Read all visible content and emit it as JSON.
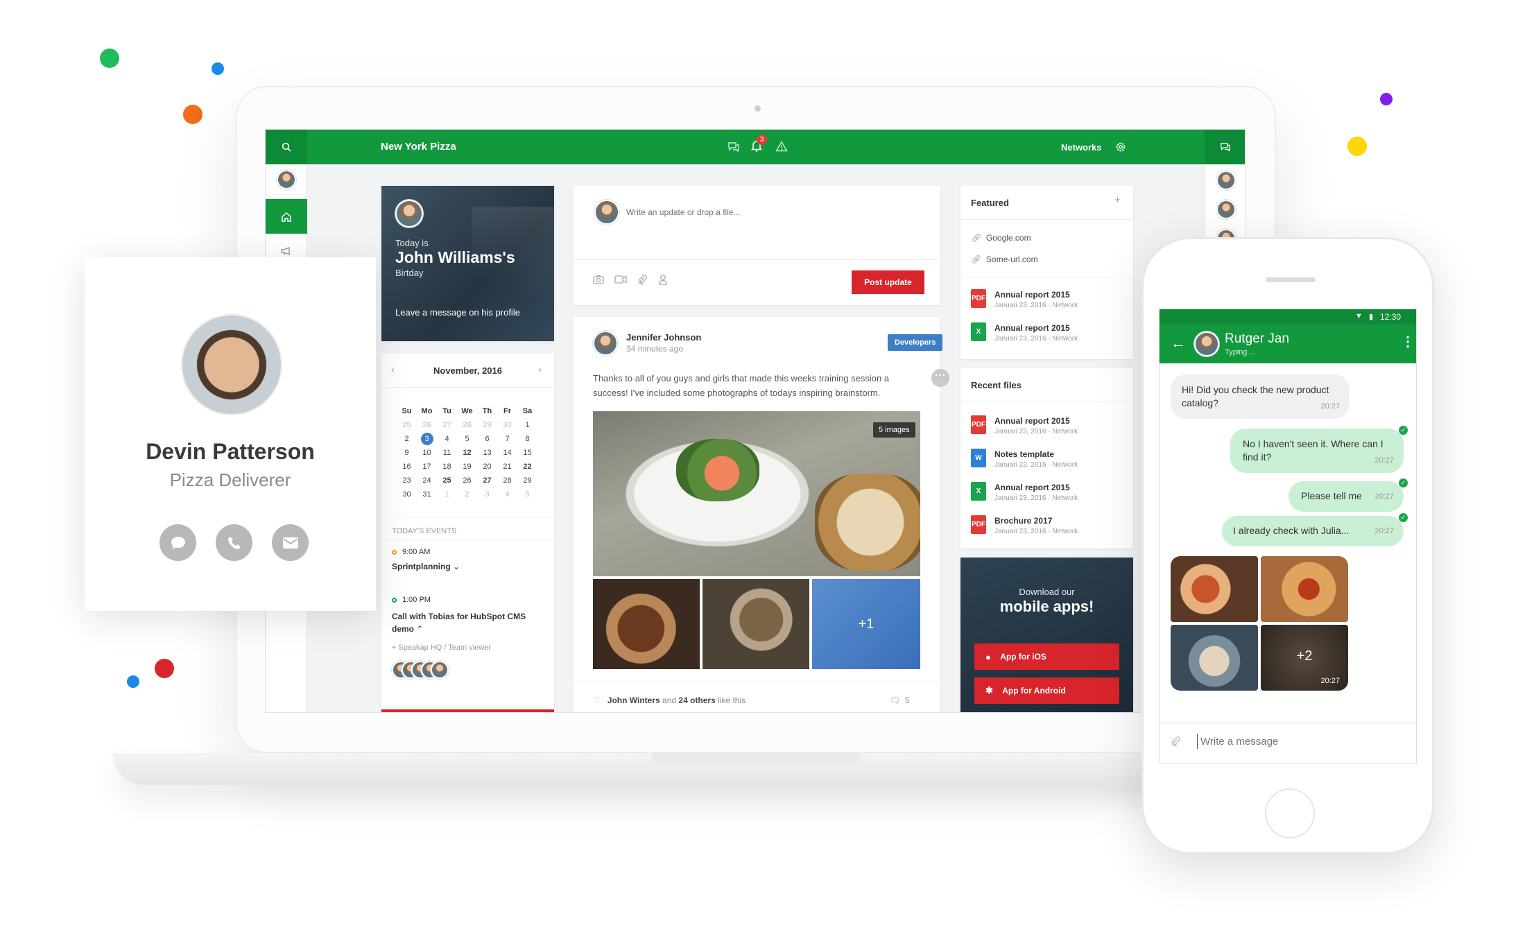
{
  "colors": {
    "brand_green": "#12993e",
    "accent_red": "#d8252b",
    "accent_blue": "#3e7ec5"
  },
  "header": {
    "title": "New York Pizza",
    "networks": "Networks",
    "notification_count": "3"
  },
  "birthday": {
    "today": "Today is",
    "name": "John Williams's",
    "subtitle": "Birtday",
    "cta": "Leave a message on his profile"
  },
  "calendar": {
    "month": "November, 2016",
    "weekdays": [
      "Su",
      "Mo",
      "Tu",
      "We",
      "Th",
      "Fr",
      "Sa"
    ],
    "weeks": [
      [
        "25",
        "26",
        "27",
        "28",
        "29",
        "30",
        "1"
      ],
      [
        "2",
        "3",
        "4",
        "5",
        "6",
        "7",
        "8"
      ],
      [
        "9",
        "10",
        "11",
        "12",
        "13",
        "14",
        "15"
      ],
      [
        "16",
        "17",
        "18",
        "19",
        "20",
        "21",
        "22"
      ],
      [
        "23",
        "24",
        "25",
        "26",
        "27",
        "28",
        "29"
      ],
      [
        "30",
        "31",
        "1",
        "2",
        "3",
        "4",
        "5"
      ]
    ]
  },
  "events": {
    "heading": "TODAY'S EVENTS",
    "items": [
      {
        "time": "9:00 AM",
        "title": "Sprintplanning"
      },
      {
        "time": "1:00 PM",
        "title": "Call with Tobias for HubSpot CMS demo",
        "location": "Speakap HQ / Team viewer"
      }
    ]
  },
  "composer": {
    "placeholder": "Write an update or drop a file...",
    "post_button": "Post update"
  },
  "post": {
    "author": "Jennifer Johnson",
    "time": "34 minutes ago",
    "tag": "Developers",
    "text": "Thanks to all of you guys and girls that made this weeks training session a success! I've included some photographs of todays inspiring brainstorm.",
    "images_badge": "5 images",
    "more_count": "+1",
    "likes_name": "John Winters",
    "likes_and": "and",
    "likes_others": "24 others",
    "likes_suffix": "like this",
    "comments": "5"
  },
  "featured": {
    "heading": "Featured",
    "links": [
      "Google.com",
      "Some-url.com"
    ],
    "files": [
      {
        "name": "Annual report 2015",
        "meta": "Januari 23, 2016 · Network",
        "type": "pdf"
      },
      {
        "name": "Annual report 2015",
        "meta": "Januari 23, 2016 · Network",
        "type": "xls"
      }
    ]
  },
  "recent": {
    "heading": "Recent files",
    "files": [
      {
        "name": "Annual report 2015",
        "meta": "Januari 23, 2016 · Network",
        "type": "pdf"
      },
      {
        "name": "Notes template",
        "meta": "Januari 23, 2016 · Network",
        "type": "doc"
      },
      {
        "name": "Annual report 2015",
        "meta": "Januari 23, 2016 · Network",
        "type": "xls"
      },
      {
        "name": "Brochure 2017",
        "meta": "Januari 23, 2016 · Network",
        "type": "pdf"
      }
    ]
  },
  "apps": {
    "line1": "Download our",
    "line2": "mobile apps!",
    "ios": "App for iOS",
    "android": "App for Android"
  },
  "profile": {
    "name": "Devin Patterson",
    "role": "Pizza Deliverer"
  },
  "phone": {
    "status_time": "12:30",
    "contact": "Rutger Jan",
    "status": "Typing ...",
    "messages": [
      {
        "text": "Hi! Did you check the new product catalog?",
        "time": "20:27"
      },
      {
        "text": "No I haven't seen it. Where can I find it?",
        "time": "20:27"
      },
      {
        "text": "Please tell me",
        "time": "20:27"
      },
      {
        "text": "I already check with Julia...",
        "time": "20:27"
      }
    ],
    "gallery_more": "+2",
    "gallery_time": "20:27",
    "input_placeholder": "Write a message"
  }
}
